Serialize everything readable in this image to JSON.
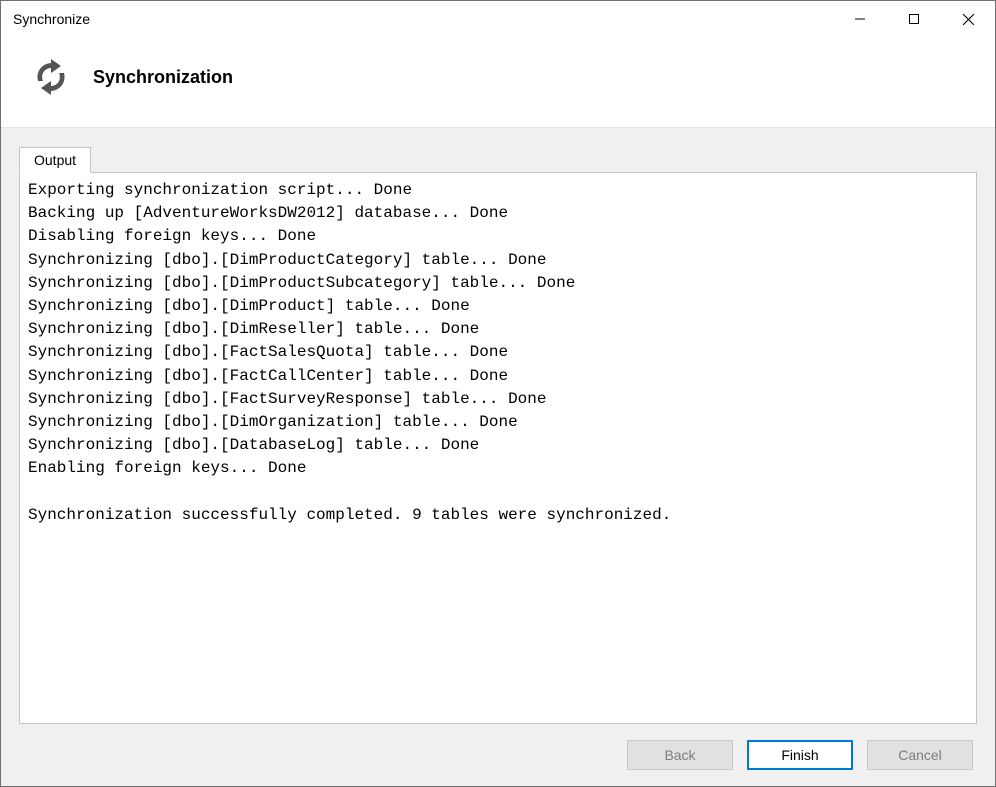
{
  "window": {
    "title": "Synchronize"
  },
  "header": {
    "title": "Synchronization"
  },
  "tabs": {
    "output_label": "Output"
  },
  "output": {
    "lines": [
      "Exporting synchronization script... Done",
      "Backing up [AdventureWorksDW2012] database... Done",
      "Disabling foreign keys... Done",
      "Synchronizing [dbo].[DimProductCategory] table... Done",
      "Synchronizing [dbo].[DimProductSubcategory] table... Done",
      "Synchronizing [dbo].[DimProduct] table... Done",
      "Synchronizing [dbo].[DimReseller] table... Done",
      "Synchronizing [dbo].[FactSalesQuota] table... Done",
      "Synchronizing [dbo].[FactCallCenter] table... Done",
      "Synchronizing [dbo].[FactSurveyResponse] table... Done",
      "Synchronizing [dbo].[DimOrganization] table... Done",
      "Synchronizing [dbo].[DatabaseLog] table... Done",
      "Enabling foreign keys... Done",
      "",
      "Synchronization successfully completed. 9 tables were synchronized."
    ]
  },
  "footer": {
    "back_label": "Back",
    "finish_label": "Finish",
    "cancel_label": "Cancel"
  }
}
